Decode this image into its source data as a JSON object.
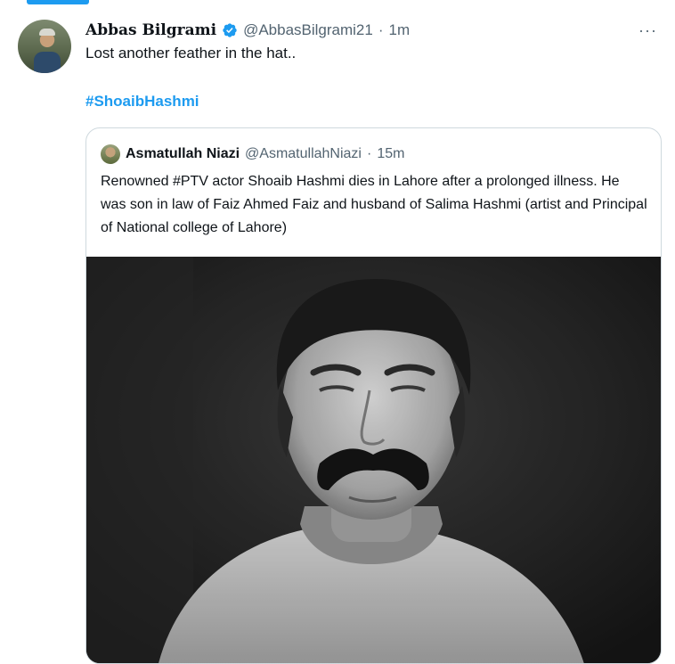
{
  "tweet": {
    "display_name": "Abbas Bilgrami",
    "handle": "@AbbasBilgrami21",
    "separator": "·",
    "time": "1m",
    "more": "···",
    "text": "Lost another feather in the hat..",
    "hashtag": "#ShoaibHashmi"
  },
  "quoted_tweet": {
    "display_name": "Asmatullah Niazi",
    "handle": "@AsmatullahNiazi",
    "separator": "·",
    "time": "15m",
    "text": "Renowned #PTV actor Shoaib Hashmi dies in Lahore after a prolonged illness. He was son in law of Faiz Ahmed Faiz and husband of Salima Hashmi (artist and Principal of National college of Lahore)"
  },
  "icons": {
    "verified": "verified-badge-icon",
    "more": "more-options-icon"
  },
  "colors": {
    "accent": "#1d9bf0",
    "secondary_text": "#536471",
    "border": "#cfd9de"
  }
}
